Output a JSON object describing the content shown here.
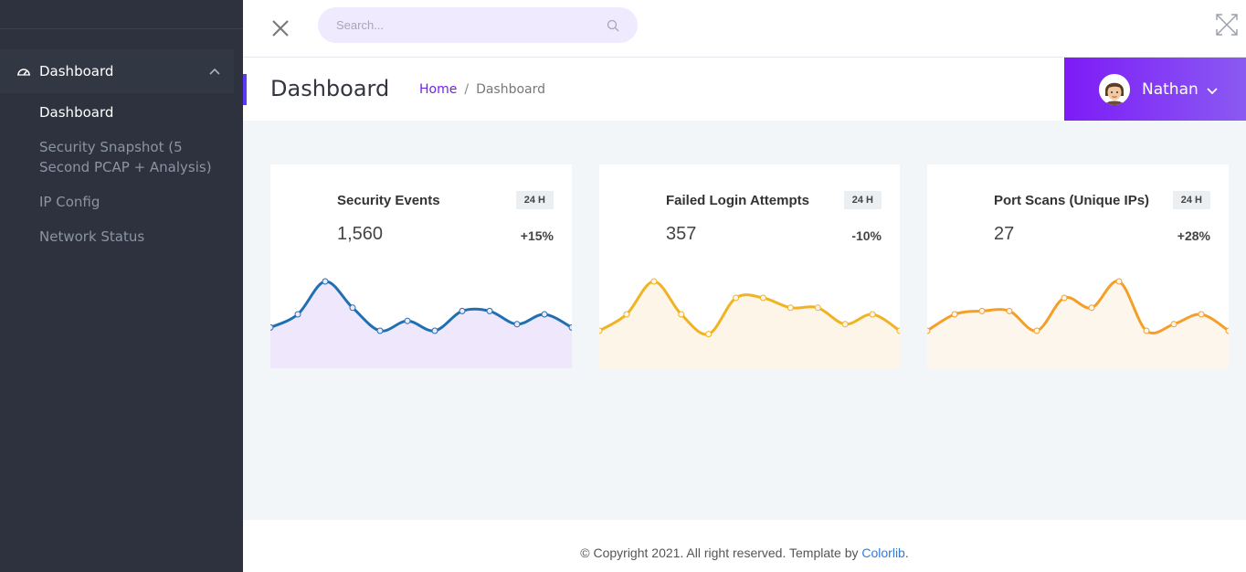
{
  "sidebar": {
    "parent": {
      "label": "Dashboard",
      "icon": "dashboard-gauge-icon"
    },
    "items": [
      {
        "label": "Dashboard",
        "active": true
      },
      {
        "label": "Security Snapshot (5 Second PCAP + Analysis)",
        "active": false
      },
      {
        "label": "IP Config",
        "active": false
      },
      {
        "label": "Network Status",
        "active": false
      }
    ]
  },
  "topbar": {
    "search_placeholder": "Search...",
    "close_icon": "close-icon",
    "search_icon": "search-icon",
    "expand_icon": "fullscreen-icon"
  },
  "header": {
    "title": "Dashboard",
    "breadcrumb": {
      "home": "Home",
      "separator": "/",
      "current": "Dashboard"
    }
  },
  "user": {
    "name": "Nathan"
  },
  "cards": [
    {
      "title": "Security Events",
      "badge": "24 H",
      "value": "1,560",
      "change": "+15%",
      "line_color": "#1f6fb2",
      "fill_color": "#efe8fc"
    },
    {
      "title": "Failed Login Attempts",
      "badge": "24 H",
      "value": "357",
      "change": "-10%",
      "line_color": "#f0b323",
      "fill_color": "#fcf5e8"
    },
    {
      "title": "Port Scans (Unique IPs)",
      "badge": "24 H",
      "value": "27",
      "change": "+28%",
      "line_color": "#f59e28",
      "fill_color": "#fdf6ec"
    }
  ],
  "chart_data": [
    {
      "type": "area",
      "series": [
        {
          "values": [
            3,
            5,
            10,
            6,
            2.5,
            4,
            2.5,
            5.5,
            5.5,
            3.5,
            5,
            3
          ]
        }
      ]
    },
    {
      "type": "area",
      "series": [
        {
          "values": [
            2.5,
            5,
            10,
            5,
            2,
            7.5,
            7.5,
            6,
            6,
            3.5,
            5,
            2.5
          ]
        }
      ]
    },
    {
      "type": "area",
      "series": [
        {
          "values": [
            2.5,
            5,
            5.5,
            5.5,
            2.5,
            7.5,
            6,
            10,
            2.5,
            3.5,
            5,
            2.5
          ]
        }
      ]
    }
  ],
  "footer": {
    "text": "© Copyright 2021. All right reserved. Template by ",
    "link": "Colorlib",
    "suffix": "."
  }
}
